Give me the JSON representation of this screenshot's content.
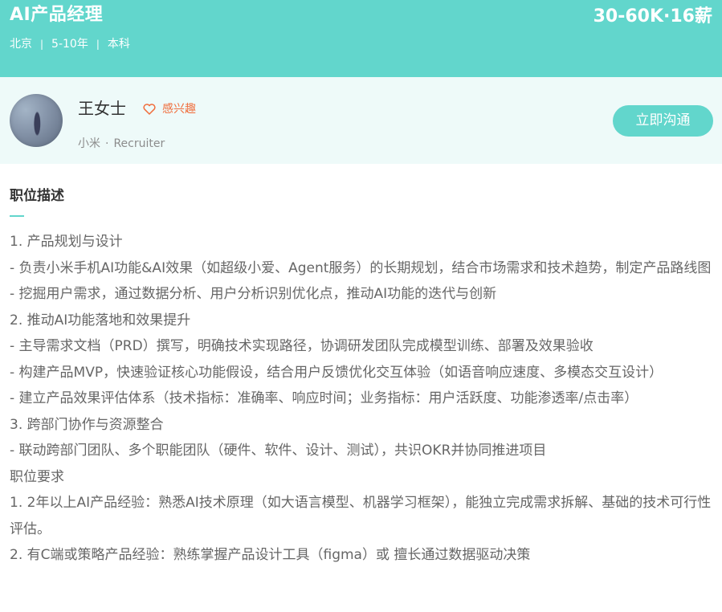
{
  "job": {
    "title": "AI产品经理",
    "salary": "30-60K·16薪",
    "meta": {
      "city": "北京",
      "experience": "5-10年",
      "education": "本科",
      "separator": "|"
    }
  },
  "recruiter": {
    "name": "王女士",
    "interest_label": "感兴趣",
    "company": "小米",
    "dot": "·",
    "role": "Recruiter",
    "chat_button": "立即沟通"
  },
  "description": {
    "title": "职位描述",
    "lines": [
      "1. 产品规划与设计",
      "- 负责小米手机AI功能&AI效果（如超级小爱、Agent服务）的长期规划，结合市场需求和技术趋势，制定产品路线图",
      "- 挖掘用户需求，通过数据分析、用户分析识别优化点，推动AI功能的迭代与创新",
      "2. 推动AI功能落地和效果提升",
      "- 主导需求文档（PRD）撰写，明确技术实现路径，协调研发团队完成模型训练、部署及效果验收",
      "- 构建产品MVP，快速验证核心功能假设，结合用户反馈优化交互体验（如语音响应速度、多模态交互设计）",
      "- 建立产品效果评估体系（技术指标：准确率、响应时间；业务指标：用户活跃度、功能渗透率/点击率）",
      "3. 跨部门协作与资源整合",
      "- 联动跨部门团队、多个职能团队（硬件、软件、设计、测试），共识OKR并协同推进项目",
      "职位要求",
      "1. 2年以上AI产品经验：熟悉AI技术原理（如大语言模型、机器学习框架），能独立完成需求拆解、基础的技术可行性评估。",
      "2. 有C端或策略产品经验：熟练掌握产品设计工具（figma）或 擅长通过数据驱动决策"
    ]
  },
  "colors": {
    "accent": "#62d6cc",
    "interest": "#f06d3c",
    "recruiter_bg": "#eefaf9"
  },
  "icons": {
    "interest": "heart-outline-icon"
  }
}
